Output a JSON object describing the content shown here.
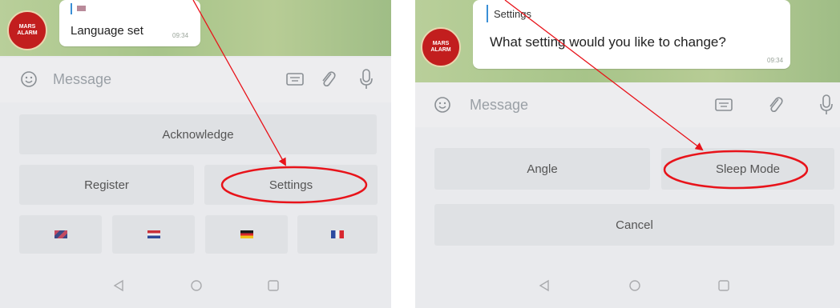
{
  "left": {
    "chat": {
      "reply_snippet": "",
      "message": "Language set",
      "time": "09:34",
      "avatar_text": "MARS ALARM"
    },
    "input": {
      "placeholder": "Message"
    },
    "keyboard": {
      "acknowledge": "Acknowledge",
      "register": "Register",
      "settings": "Settings",
      "flags": [
        "uk-flag",
        "nl-flag",
        "de-flag",
        "fr-flag"
      ]
    }
  },
  "right": {
    "chat": {
      "reply_title": "Settings",
      "message": "What setting would you like to change?",
      "time": "09:34",
      "avatar_text": "MARS ALARM"
    },
    "input": {
      "placeholder": "Message"
    },
    "keyboard": {
      "angle": "Angle",
      "sleep_mode": "Sleep Mode",
      "cancel": "Cancel"
    }
  },
  "nav_icons": [
    "back-icon",
    "home-icon",
    "recents-icon"
  ],
  "colors": {
    "annotation": "#e8131a",
    "chat_background": "#a9c68b",
    "avatar": "#c21e1e",
    "keyboard_button": "#dfe1e4"
  }
}
